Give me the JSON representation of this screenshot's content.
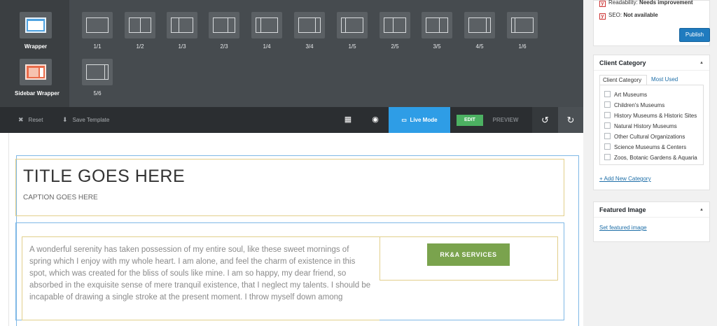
{
  "layouts": {
    "wrappers": [
      {
        "label": "Wrapper",
        "icon": "wrapper-icon"
      },
      {
        "label": "Sidebar Wrapper",
        "icon": "sidebar-wrapper-icon"
      }
    ],
    "columns": [
      "1/1",
      "1/2",
      "1/3",
      "2/3",
      "1/4",
      "3/4",
      "1/5",
      "2/5",
      "3/5",
      "4/5",
      "1/6",
      "5/6"
    ]
  },
  "toolbar": {
    "reset_label": "Reset",
    "save_template_label": "Save Template",
    "live_mode_label": "Live Mode",
    "edit_label": "EDIT",
    "preview_label": "PREVIEW"
  },
  "canvas": {
    "title": "TITLE GOES HERE",
    "caption": "CAPTION GOES HERE",
    "body_text": "A wonderful serenity has taken possession of my entire soul, like these sweet mornings of spring which I enjoy with my whole heart. I am alone, and feel the charm of existence in this spot, which was created for the bliss of souls like mine. I am so happy, my dear friend, so absorbed in the exquisite sense of mere tranquil existence, that I neglect my talents. I should be incapable of drawing a single stroke at the present moment. I throw myself down among",
    "button_label": "RK&A SERVICES"
  },
  "publish": {
    "readability_label": "Readability:",
    "readability_value": "Needs improvement",
    "seo_label": "SEO:",
    "seo_value": "Not available",
    "publish_label": "Publish"
  },
  "category": {
    "title": "Client Category",
    "tabs": [
      "Client Category",
      "Most Used"
    ],
    "items": [
      "Art Museums",
      "Children's Museums",
      "History Museums & Historic Sites",
      "Natural History Museums",
      "Other Cultural Organizations",
      "Science Museums & Centers",
      "Zoos, Botanic Gardens & Aquaria"
    ],
    "add_new_label": "+ Add New Category"
  },
  "featured": {
    "title": "Featured Image",
    "set_label": "Set featured image"
  },
  "colors": {
    "accent_blue": "#2e9de6",
    "edit_green": "#4cb162",
    "button_green": "#7aa34d",
    "publish_blue": "#1f7bbf"
  }
}
